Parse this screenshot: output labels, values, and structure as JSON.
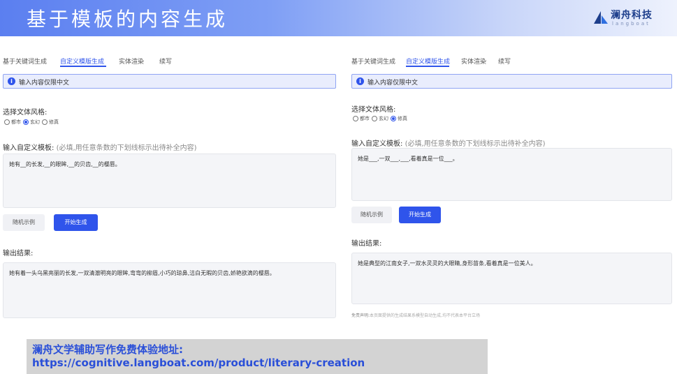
{
  "header": {
    "title": "基于模板的内容生成",
    "logo_cn": "澜舟科技",
    "logo_en": "langboat",
    "logo_icon": "sail-logo-icon"
  },
  "colors": {
    "accent": "#2f54eb",
    "notice_bg": "#e9edfd",
    "footer_link": "#2a4fd8"
  },
  "left_panel": {
    "tabs": [
      "基于关键词生成",
      "自定义模版生成",
      "实体渲染",
      "续写"
    ],
    "active_tab": 1,
    "notice": "输入内容仅限中文",
    "style_label": "选择文体风格:",
    "styles": [
      "都市",
      "玄幻",
      "修真"
    ],
    "selected_style": 1,
    "template_label": "输入自定义模板:",
    "template_hint": "(必填,用任意条数的下划线标示出待补全内容)",
    "template_value": "她有__的长发,__的眼眸,__的贝齿,__的樱唇。",
    "random_button": "随机示例",
    "generate_button": "开始生成",
    "output_label": "输出结果:",
    "output_value": "她有着一头乌黑亮丽的长发,一双清澈明亮的眼眸,弯弯的柳眉,小巧的琼鼻,洁白无暇的贝齿,娇艳欲滴的樱唇。"
  },
  "right_panel": {
    "tabs": [
      "基于关键词生成",
      "自定义模版生成",
      "实体渲染",
      "续写"
    ],
    "active_tab": 1,
    "notice": "输入内容仅限中文",
    "style_label": "选择文体风格:",
    "styles": [
      "都市",
      "玄幻",
      "修真"
    ],
    "selected_style": 2,
    "template_label": "输入自定义模板:",
    "template_hint": "(必填,用任意条数的下划线标示出待补全内容)",
    "template_value": "她是___,一双___,___,看着真是一位___。",
    "random_button": "随机示例",
    "generate_button": "开始生成",
    "output_label": "输出结果:",
    "output_value": "她是典型的江南女子,一双水灵灵的大眼睛,身形苗条,看着真是一位美人。",
    "disclaimer_label": "免责声明:",
    "disclaimer_text": "本页面提供的生成结果系模型自动生成,均不代表本平台立场"
  },
  "footer": {
    "line1": "澜舟文学辅助写作免费体验地址:",
    "line2": "https://cognitive.langboat.com/product/literary-creation"
  }
}
